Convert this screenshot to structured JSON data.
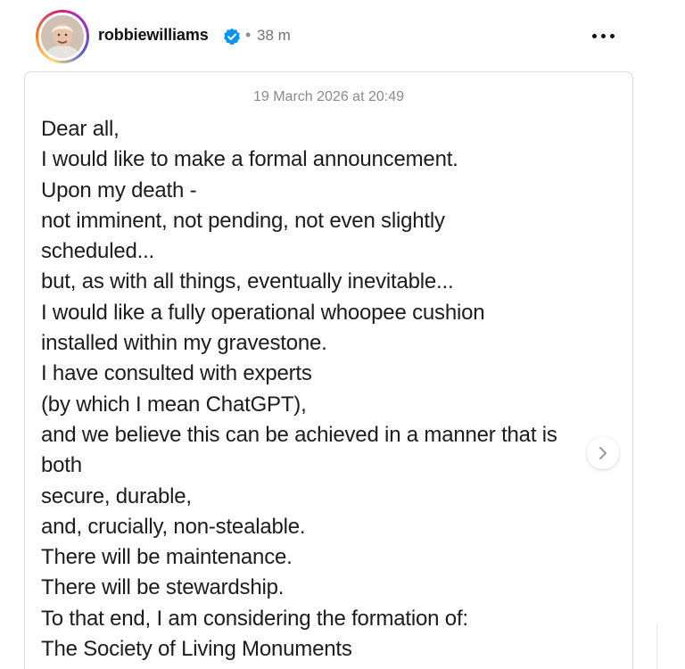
{
  "post": {
    "username": "robbiewilliams",
    "separator": "•",
    "time_ago": "38 m",
    "avatar_icon": "profile-photo",
    "verified_icon": "verified-badge-icon",
    "more_icon": "more-options-icon"
  },
  "note": {
    "date": "19 March 2026 at 20:49",
    "lines": [
      "Dear all,",
      "I would like to make a formal announcement.",
      "Upon my death -",
      "not imminent, not pending, not even slightly",
      "scheduled...",
      "but, as with all things, eventually inevitable...",
      "I would like a fully operational whoopee cushion",
      "installed within my gravestone.",
      "I have consulted with experts",
      "(by which I mean ChatGPT),",
      "and we believe this can be achieved in a manner that is",
      "both",
      "secure, durable,",
      "and, crucially, non-stealable.",
      "There will be maintenance.",
      "There will be stewardship.",
      "To that end, I am considering the formation of:",
      "The Society of Living Monuments"
    ]
  },
  "carousel": {
    "next_icon": "chevron-right-icon"
  },
  "colors": {
    "verified_blue": "#0095f6",
    "muted_text": "#737373",
    "card_border": "#dbdbdb"
  }
}
